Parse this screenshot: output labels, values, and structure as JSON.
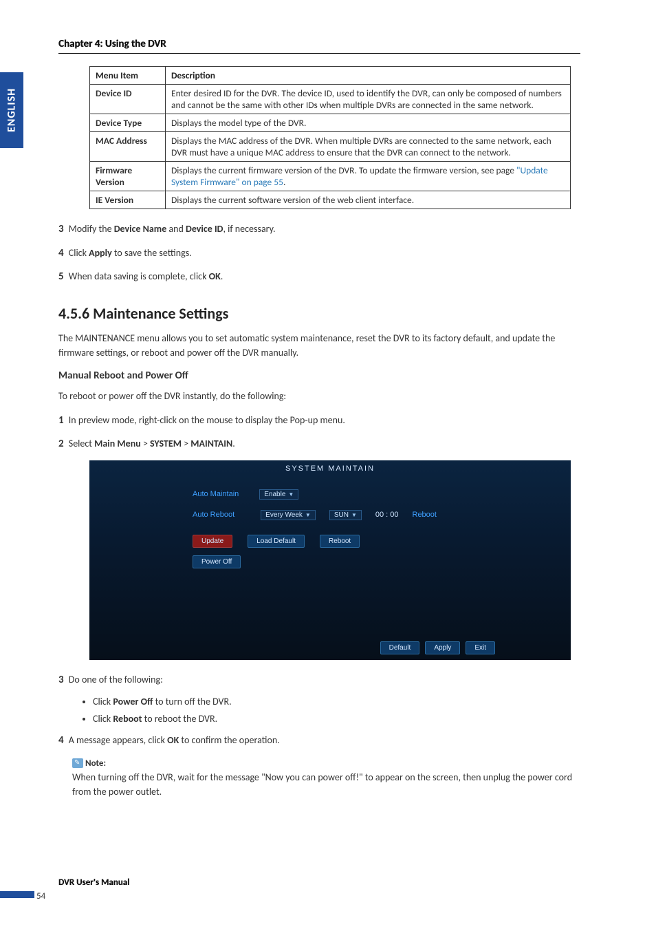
{
  "sideTab": "ENGLISH",
  "chapterTitle": "Chapter 4: Using the DVR",
  "table": {
    "headers": [
      "Menu Item",
      "Description"
    ],
    "rows": [
      {
        "c1": "Device ID",
        "c2": "Enter desired ID for the DVR. The device ID, used to identify the DVR, can only be composed of numbers and cannot be the same with other IDs when multiple DVRs are connected in the same network."
      },
      {
        "c1": "Device Type",
        "c2": "Displays the model type of the DVR."
      },
      {
        "c1": "MAC Address",
        "c2": "Displays the MAC address of the DVR. When multiple DVRs are connected to the same network, each DVR must have a unique MAC address to ensure that the DVR can connect to the network."
      },
      {
        "c1": "Firmware Version",
        "c2_part1": "Displays the current firmware version of the DVR. To update the firmware version, see page ",
        "c2_link": "\"Update System Firmware\" on page 55",
        "c2_part2": "."
      },
      {
        "c1": "IE Version",
        "c2": "Displays the current software version of the web client interface."
      }
    ]
  },
  "steps1": {
    "s3": {
      "n": "3",
      "pre": "Modify the ",
      "b1": "Device Name",
      "mid": " and ",
      "b2": "Device ID",
      "post": ", if necessary."
    },
    "s4": {
      "n": "4",
      "pre": "Click ",
      "b1": "Apply",
      "post": " to save the settings."
    },
    "s5": {
      "n": "5",
      "pre": "When data saving is complete, click ",
      "b1": "OK",
      "post": "."
    }
  },
  "sectionHeading": "4.5.6 Maintenance Settings",
  "sectionIntro": "The MAINTENANCE menu allows you to set automatic system maintenance, reset the DVR to its factory default, and update the firmware settings, or reboot and power off the DVR manually.",
  "subHeading": "Manual Reboot and Power Off",
  "subIntro": "To reboot or power off the DVR instantly,  do the following:",
  "steps2": {
    "s1": {
      "n": "1",
      "text": "In preview mode, right-click on the mouse to display the Pop-up menu."
    },
    "s2": {
      "n": "2",
      "pre": "Select ",
      "b1": "Main Menu",
      "sep1": " > ",
      "b2": "SYSTEM",
      "sep2": " > ",
      "b3": "MAINTAIN",
      "post": "."
    }
  },
  "screenshot": {
    "title": "SYSTEM  MAINTAIN",
    "autoMaintainLabel": "Auto  Maintain",
    "enableSel": "Enable",
    "autoRebootLabel": "Auto  Reboot",
    "everyWeekSel": "Every  Week",
    "daySel": "SUN",
    "time": "00 : 00",
    "rebootLbl": "Reboot",
    "updateBtn": "Update",
    "loadDefaultBtn": "Load  Default",
    "rebootBtn": "Reboot",
    "powerOffBtn": "Power  Off",
    "defaultBtn": "Default",
    "applyBtn": "Apply",
    "exitBtn": "Exit"
  },
  "steps3": {
    "s3": {
      "n": "3",
      "text": "Do one of the following:"
    },
    "bullets": [
      {
        "pre": "Click ",
        "b": "Power Off",
        "post": " to turn off the DVR."
      },
      {
        "pre": "Click ",
        "b": "Reboot",
        "post": " to reboot the DVR."
      }
    ],
    "s4": {
      "n": "4",
      "pre": "A message appears, click ",
      "b1": "OK",
      "post": " to confirm the operation."
    }
  },
  "note": {
    "label": "Note:",
    "text": "When turning off the DVR, wait for the message \"Now you can power off!\" to appear on the screen, then unplug the power cord from the power outlet."
  },
  "footerManual": "DVR User's Manual",
  "pageNum": "54"
}
